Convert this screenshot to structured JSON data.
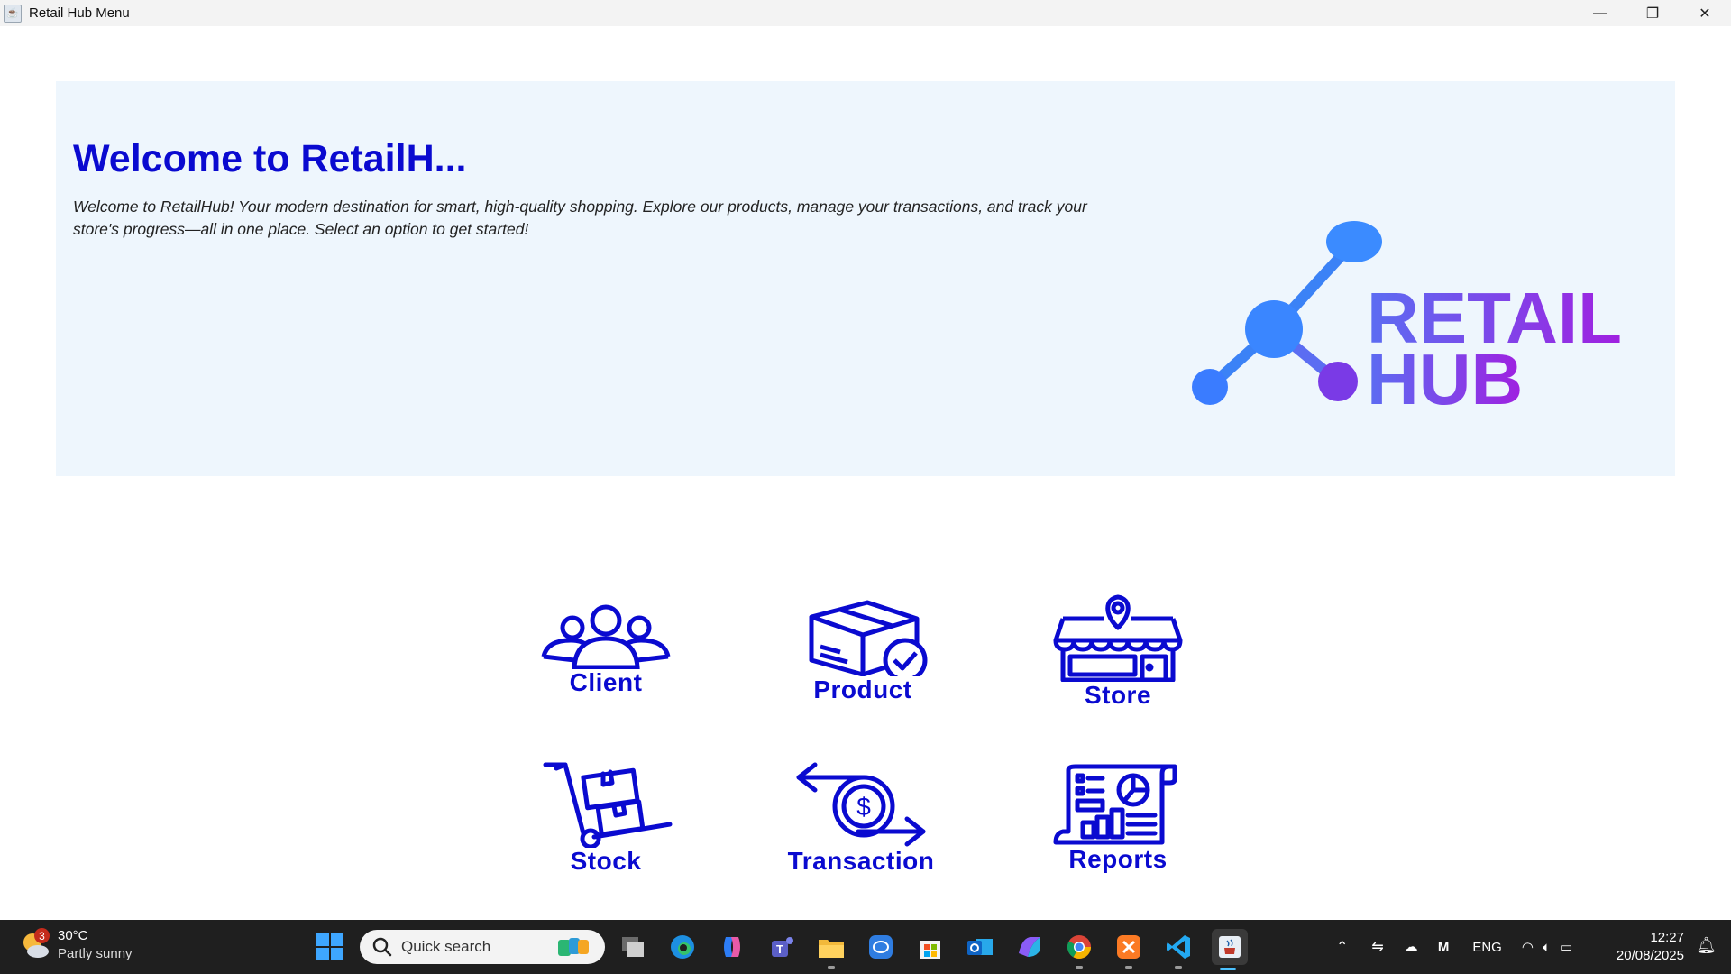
{
  "window": {
    "title": "Retail Hub Menu",
    "controls": {
      "minimize": "—",
      "maximize": "❐",
      "close": "✕"
    }
  },
  "banner": {
    "heading": "Welcome to RetailH...",
    "description": "Welcome to RetailHub! Your modern destination for smart, high-quality shopping. Explore our products, manage your transactions, and track your store's progress—all in one place. Select an option to get started!",
    "logo": {
      "line1": "RETAIL",
      "line2": "HUB"
    }
  },
  "menu": {
    "client": "Client",
    "product": "Product",
    "store": "Store",
    "stock": "Stock",
    "transaction": "Transaction",
    "reports": "Reports"
  },
  "colors": {
    "accent": "#0a0ad0",
    "banner_bg": "#eef6fd",
    "logo_blue": "#3b82f6",
    "logo_purple": "#8b1fd6"
  },
  "taskbar": {
    "weather": {
      "temp": "30°C",
      "condition": "Partly sunny",
      "badge": "3"
    },
    "search_placeholder": "Quick search",
    "apps": [
      "task-view-icon",
      "edge-icon",
      "copilot-icon",
      "teams-icon",
      "file-explorer-icon",
      "chat-icon",
      "store-app-icon",
      "outlook-icon",
      "m365-icon",
      "chrome-icon",
      "xampp-icon",
      "vscode-icon",
      "java-app-icon"
    ],
    "tray": {
      "language": "ENG"
    },
    "clock": {
      "time": "12:27",
      "date": "20/08/2025"
    }
  }
}
